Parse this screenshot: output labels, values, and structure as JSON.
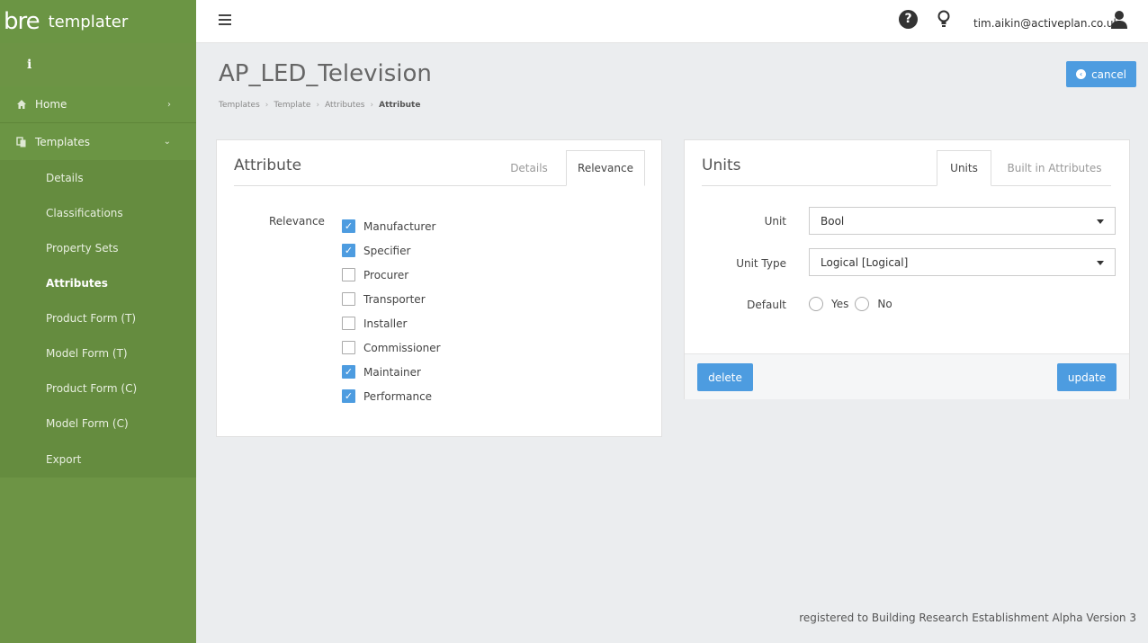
{
  "brand": {
    "logo": "bre",
    "name": "templater"
  },
  "sidebar": {
    "info_label": "i",
    "home_label": "Home",
    "templates_label": "Templates",
    "sub_items": [
      {
        "label": "Details"
      },
      {
        "label": "Classifications"
      },
      {
        "label": "Property Sets"
      },
      {
        "label": "Attributes"
      },
      {
        "label": "Product Form (T)"
      },
      {
        "label": "Model Form (T)"
      },
      {
        "label": "Product Form (C)"
      },
      {
        "label": "Model Form (C)"
      },
      {
        "label": "Export"
      }
    ]
  },
  "topbar": {
    "user_email": "tim.aikin@activeplan.co.uk",
    "help_glyph": "?"
  },
  "page": {
    "title": "AP_LED_Television",
    "breadcrumb": [
      "Templates",
      "Template",
      "Attributes",
      "Attribute"
    ],
    "cancel_label": "cancel"
  },
  "attribute_panel": {
    "heading": "Attribute",
    "tabs": [
      {
        "label": "Details"
      },
      {
        "label": "Relevance"
      }
    ],
    "relevance_label": "Relevance",
    "relevance_options": [
      {
        "label": "Manufacturer",
        "checked": true
      },
      {
        "label": "Specifier",
        "checked": true
      },
      {
        "label": "Procurer",
        "checked": false
      },
      {
        "label": "Transporter",
        "checked": false
      },
      {
        "label": "Installer",
        "checked": false
      },
      {
        "label": "Commissioner",
        "checked": false
      },
      {
        "label": "Maintainer",
        "checked": true
      },
      {
        "label": "Performance",
        "checked": true
      }
    ]
  },
  "units_panel": {
    "heading": "Units",
    "tabs": [
      {
        "label": "Units"
      },
      {
        "label": "Built in Attributes"
      }
    ],
    "unit_label": "Unit",
    "unit_value": "Bool",
    "unit_type_label": "Unit Type",
    "unit_type_value": "Logical [Logical]",
    "default_label": "Default",
    "default_yes": "Yes",
    "default_no": "No",
    "delete_label": "delete",
    "update_label": "update"
  },
  "footer": {
    "text": "registered to Building Research Establishment Alpha Version 3"
  },
  "colors": {
    "sidebar": "#6d9445",
    "accent": "#4d9ce0",
    "background": "#ebedef"
  }
}
